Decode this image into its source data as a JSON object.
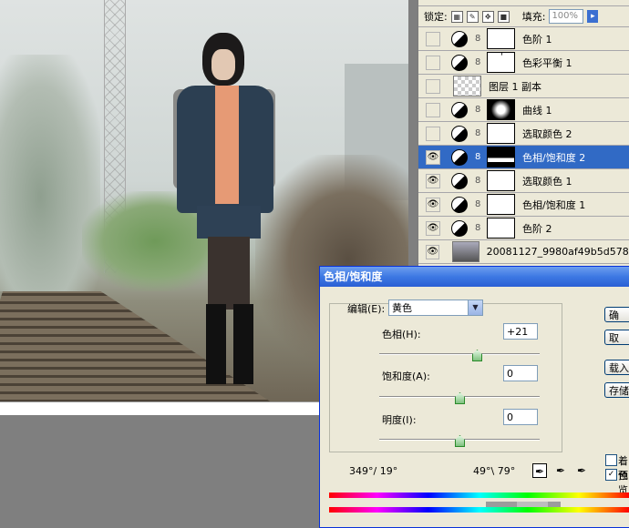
{
  "layers_panel": {
    "lock_label": "锁定:",
    "fill_label": "填充:",
    "fill_value": "100%",
    "layers": [
      {
        "name": "色阶 1",
        "visible": false,
        "type": "adjustment",
        "mask": "white"
      },
      {
        "name": "色彩平衡 1",
        "visible": false,
        "type": "adjustment",
        "mask": "tick"
      },
      {
        "name": "图层 1 副本",
        "visible": false,
        "type": "pixel",
        "mask": "none"
      },
      {
        "name": "曲线 1",
        "visible": false,
        "type": "adjustment",
        "mask": "curve"
      },
      {
        "name": "选取颜色 2",
        "visible": false,
        "type": "adjustment",
        "mask": "white"
      },
      {
        "name": "色相/饱和度 2",
        "visible": true,
        "type": "adjustment",
        "mask": "selmask",
        "selected": true
      },
      {
        "name": "选取颜色 1",
        "visible": true,
        "type": "adjustment",
        "mask": "white"
      },
      {
        "name": "色相/饱和度 1",
        "visible": true,
        "type": "adjustment",
        "mask": "white"
      },
      {
        "name": "色阶 2",
        "visible": true,
        "type": "adjustment",
        "mask": "white"
      },
      {
        "name": "20081127_9980af49b5d578...",
        "visible": true,
        "type": "photo",
        "mask": "none"
      }
    ]
  },
  "dialog": {
    "title": "色相/饱和度",
    "edit_label": "编辑(E):",
    "edit_value": "黄色",
    "hue_label": "色相(H):",
    "hue_value": "+21",
    "saturation_label": "饱和度(A):",
    "saturation_value": "0",
    "lightness_label": "明度(I):",
    "lightness_value": "0",
    "range_left": "349°/ 19°",
    "range_right": "49°\\ 79°",
    "buttons": {
      "ok": "确",
      "cancel": "取",
      "load": "载入",
      "save": "存储"
    },
    "colorize_label": "着色",
    "preview_label": "预览",
    "colorize_checked": false,
    "preview_checked": true
  }
}
